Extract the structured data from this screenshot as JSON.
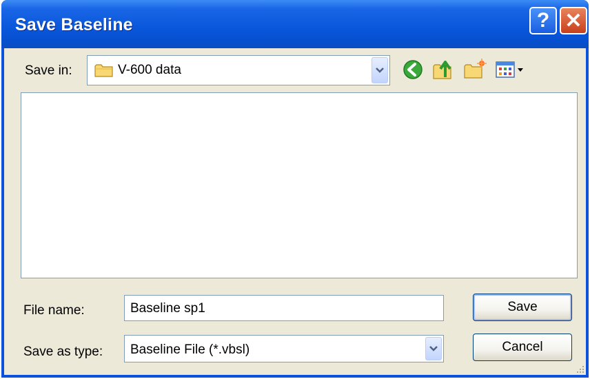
{
  "window": {
    "title": "Save Baseline",
    "help_glyph": "?",
    "close_glyph": "✕"
  },
  "save_in": {
    "label": "Save in:",
    "value": "V-600 data"
  },
  "toolbar": {
    "icons": [
      "back-icon",
      "up-folder-icon",
      "new-folder-icon",
      "views-menu-icon"
    ]
  },
  "file_name": {
    "label": "File name:",
    "value": "Baseline sp1"
  },
  "save_as_type": {
    "label": "Save as type:",
    "value": "Baseline File (*.vbsl)"
  },
  "buttons": {
    "save": "Save",
    "cancel": "Cancel"
  },
  "colors": {
    "titlebar": "#0a58dc",
    "dialog_face": "#ece9d8",
    "close_button": "#c8401c"
  }
}
